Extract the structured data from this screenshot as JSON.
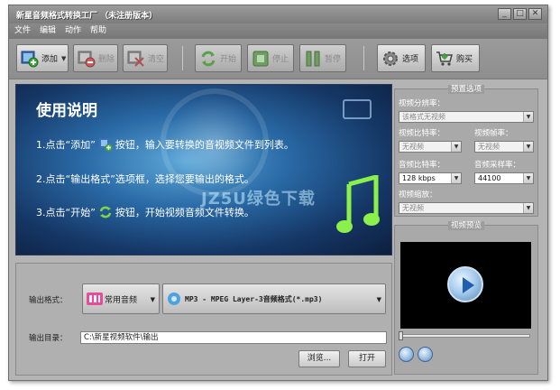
{
  "window": {
    "title": "新星音频格式转换工厂 （未注册版本）",
    "controls": [
      "_",
      "□",
      "✕"
    ]
  },
  "menu": [
    "文件",
    "编辑",
    "动作",
    "帮助"
  ],
  "toolbar": {
    "add": "添加",
    "delete": "删除",
    "clear": "清空",
    "start": "开始",
    "stop": "停止",
    "pause": "暂停",
    "options": "选项",
    "buy": "购买"
  },
  "banner": {
    "title": "使用说明",
    "step1_a": "1.点击“添加”",
    "step1_b": "按钮，输入要转换的音视频文件到列表。",
    "step2": "2.点击“输出格式”选项框，选择您要输出的格式。",
    "step3_a": "3.点击“开始”",
    "step3_b": "按钮，开始视频音频文件转换。",
    "watermark": "JZ5U绿色下载"
  },
  "output": {
    "format_label": "输出格式：",
    "category": "常用音频",
    "format": "MP3 - MPEG Layer-3音频格式(*.mp3)",
    "dir_label": "输出目录：",
    "dir_value": "C:\\新星视频软件\\输出",
    "browse": "浏览...",
    "open": "打开"
  },
  "preset": {
    "title": "预置选项",
    "resolution_label": "视频分辨率：",
    "resolution_value": "该格式无视频",
    "vbitrate_label": "视频比特率：",
    "vbitrate_value": "无视频",
    "framerate_label": "视频帧率：",
    "framerate_value": "无视频",
    "abitrate_label": "音频比特率：",
    "abitrate_value": "128 kbps",
    "samplerate_label": "音频采样率：",
    "samplerate_value": "44100",
    "scale_label": "视频缩放：",
    "scale_value": "无视频"
  },
  "preview": {
    "title": "视频预览"
  }
}
